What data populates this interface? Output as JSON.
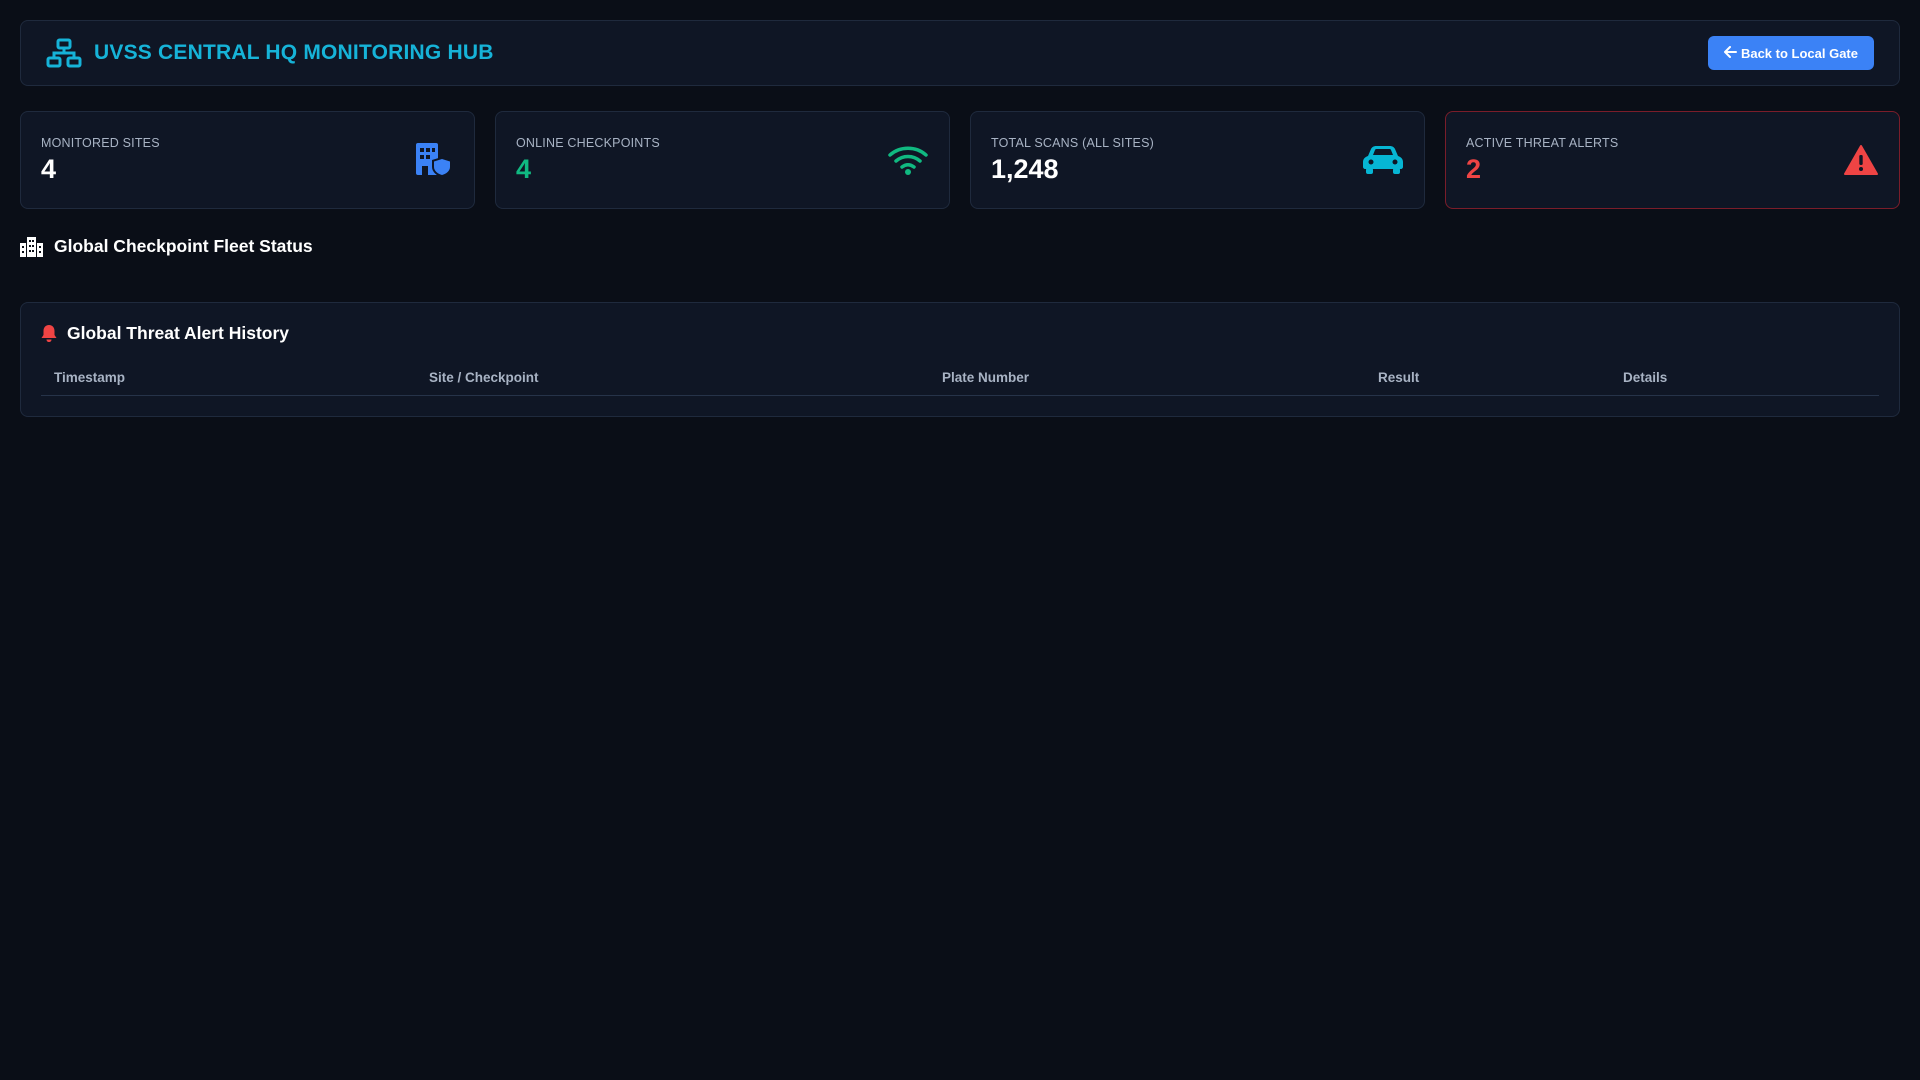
{
  "header": {
    "title": "UVSS CENTRAL HQ MONITORING HUB",
    "brand_icon": "network-icon",
    "back_button_label": "Back to Local Gate",
    "back_icon": "arrow-left-icon"
  },
  "stats": [
    {
      "label": "MONITORED SITES",
      "value": "4",
      "icon": "building-shield-icon",
      "color": "#3b82f6"
    },
    {
      "label": "ONLINE CHECKPOINTS",
      "value": "4",
      "icon": "wifi-icon",
      "color": "#10b981"
    },
    {
      "label": "TOTAL SCANS (ALL SITES)",
      "value": "1,248",
      "icon": "car-icon",
      "color": "#06b6d4"
    },
    {
      "label": "ACTIVE THREAT ALERTS",
      "value": "2",
      "icon": "warning-icon",
      "color": "#ef4444"
    }
  ],
  "fleet_section": {
    "title": "Global Checkpoint Fleet Status",
    "icon": "city-icon"
  },
  "alert_history": {
    "title": "Global Threat Alert History",
    "icon": "bell-icon",
    "columns": [
      "Timestamp",
      "Site / Checkpoint",
      "Plate Number",
      "Result",
      "Details"
    ],
    "rows": []
  },
  "colors": {
    "background": "#0a0e17",
    "panel": "#0f1625",
    "accent": "#16b3d8",
    "button": "#3b82f6",
    "success": "#10b981",
    "danger": "#ef4444"
  }
}
